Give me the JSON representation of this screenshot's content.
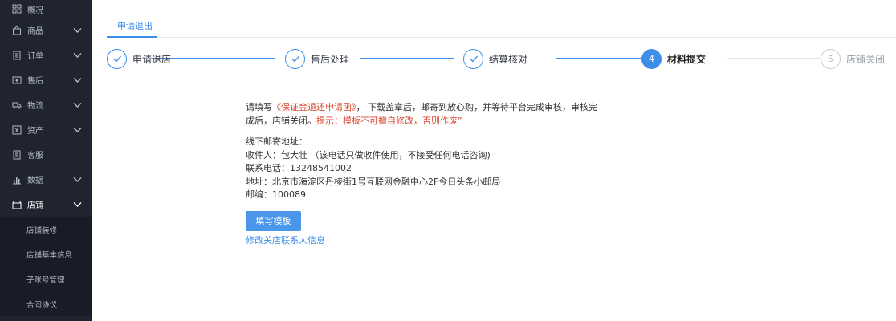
{
  "sidebar": {
    "items": [
      {
        "label": "概况",
        "icon": "dashboard-icon",
        "chevron": false
      },
      {
        "label": "商品",
        "icon": "bag-icon",
        "chevron": true
      },
      {
        "label": "订单",
        "icon": "order-icon",
        "chevron": true
      },
      {
        "label": "售后",
        "icon": "aftersale-icon",
        "chevron": true
      },
      {
        "label": "物流",
        "icon": "truck-icon",
        "chevron": true
      },
      {
        "label": "资产",
        "icon": "asset-icon",
        "chevron": true
      },
      {
        "label": "客服",
        "icon": "service-icon",
        "chevron": false
      },
      {
        "label": "数据",
        "icon": "chart-icon",
        "chevron": true
      },
      {
        "label": "店铺",
        "icon": "shop-icon",
        "chevron": true,
        "active": true
      }
    ],
    "sub_items": [
      "店铺装修",
      "店铺基本信息",
      "子账号管理",
      "合同协议"
    ]
  },
  "tab": {
    "label": "申请退出"
  },
  "steps": [
    {
      "label": "申请退店",
      "status": "done"
    },
    {
      "label": "售后处理",
      "status": "done"
    },
    {
      "label": "结算核对",
      "status": "done"
    },
    {
      "label": "材料提交",
      "number": "4",
      "status": "current"
    },
    {
      "label": "店铺关闭",
      "number": "5",
      "status": "pending"
    }
  ],
  "notice": {
    "prefix": "请填写",
    "form_name": "《保证金退还申请函》",
    "middle": "， 下载盖章后，邮寄到放心购，并等待平台完成审核，审核完成后，店铺关闭。",
    "warning": "提示：模板不可擅自修改，否则作废”"
  },
  "address": {
    "title": "线下邮寄地址：",
    "recipient": "收件人：包大壮 （该电话只做收件使用，不接受任何电话咨询)",
    "phone": "联系电话：13248541002",
    "addr": "地址：北京市海淀区丹棱街1号互联网金融中心2F今日头条小邮局",
    "zip": "邮编：100089"
  },
  "actions": {
    "fill_button": "填写模板",
    "edit_link": "修改关店联系人信息"
  },
  "colors": {
    "accent": "#3d8ee8",
    "warning": "#d9482f",
    "sidebar_bg": "#1f2430"
  }
}
